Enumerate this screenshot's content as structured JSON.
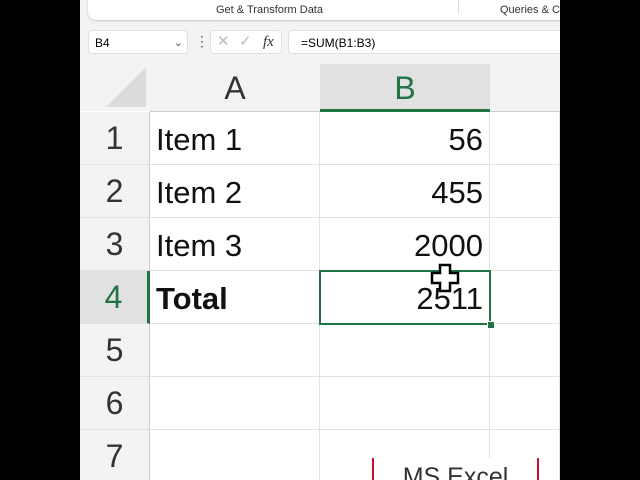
{
  "ribbon": {
    "group1": "Get & Transform Data",
    "group2": "Queries & C"
  },
  "formula_bar": {
    "name_box": "B4",
    "formula": "=SUM(B1:B3)",
    "cancel": "✕",
    "enter": "✓",
    "fx": "fx"
  },
  "columns": [
    "A",
    "B"
  ],
  "rows": [
    {
      "num": "1",
      "a": "Item 1",
      "b": "56"
    },
    {
      "num": "2",
      "a": "Item 2",
      "b": "455"
    },
    {
      "num": "3",
      "a": "Item 3",
      "b": "2000"
    },
    {
      "num": "4",
      "a": "Total",
      "b": "2511"
    },
    {
      "num": "5",
      "a": "",
      "b": ""
    },
    {
      "num": "6",
      "a": "",
      "b": ""
    },
    {
      "num": "7",
      "a": "",
      "b": ""
    }
  ],
  "watermark": "MS Excel",
  "colors": {
    "accent": "#217346",
    "watermark_bar": "#c8102e"
  }
}
